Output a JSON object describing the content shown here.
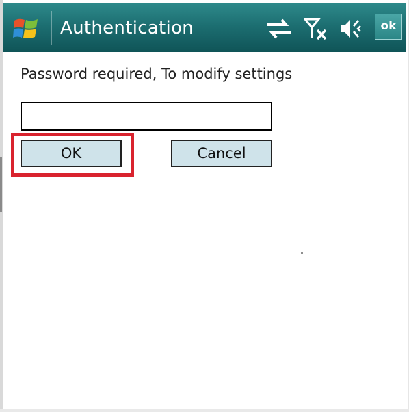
{
  "window": {
    "title": "Authentication",
    "ok_label": "ok"
  },
  "status_icons": [
    "connectivity-icon",
    "no-signal-icon",
    "volume-icon"
  ],
  "dialog": {
    "prompt": "Password required, To modify settings",
    "password_value": "",
    "ok_label": "OK",
    "cancel_label": "Cancel"
  },
  "colors": {
    "titlebar": "#1d6f72",
    "button_fill": "#cfe3ea",
    "highlight": "#d9232e"
  }
}
